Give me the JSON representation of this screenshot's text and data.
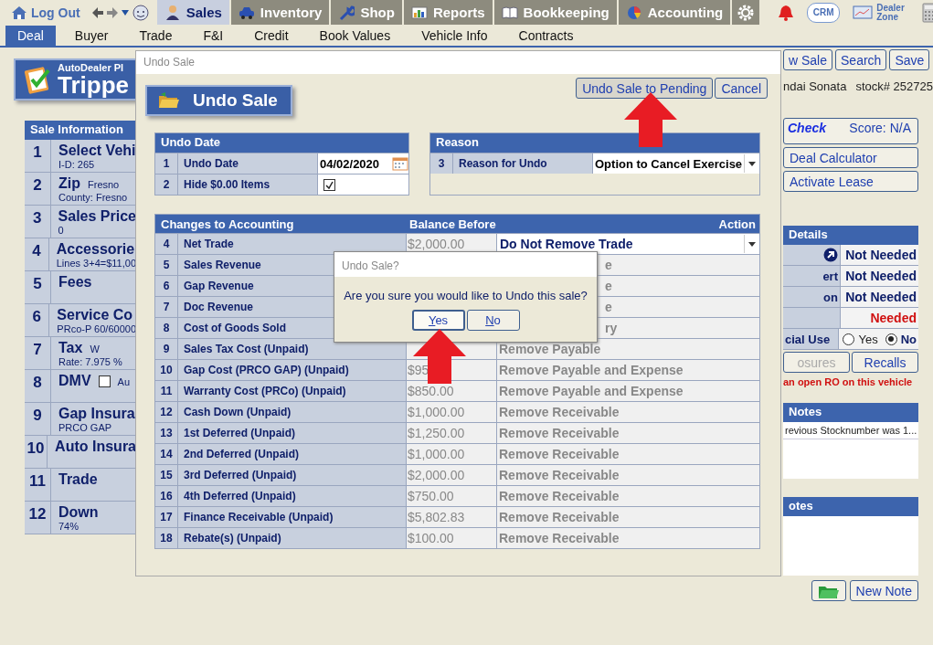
{
  "nav": {
    "logout": "Log Out",
    "tabs": [
      {
        "label": "Sales",
        "selected": true
      },
      {
        "label": "Inventory",
        "selected": false
      },
      {
        "label": "Shop",
        "selected": false
      },
      {
        "label": "Reports",
        "selected": false
      },
      {
        "label": "Bookkeeping",
        "selected": false
      },
      {
        "label": "Accounting",
        "selected": false
      }
    ],
    "crm": "CRM",
    "dealer_zone": "Dealer Zone"
  },
  "subtabs": [
    {
      "label": "Deal",
      "selected": true
    },
    {
      "label": "Buyer",
      "selected": false
    },
    {
      "label": "Trade",
      "selected": false
    },
    {
      "label": "F&I",
      "selected": false
    },
    {
      "label": "Credit",
      "selected": false
    },
    {
      "label": "Book Values",
      "selected": false
    },
    {
      "label": "Vehicle Info",
      "selected": false
    },
    {
      "label": "Contracts",
      "selected": false
    }
  ],
  "logo": {
    "line1": "AutoDealer Pl",
    "line2": "Trippe"
  },
  "sale_info": {
    "title": "Sale Information",
    "rows": [
      {
        "num": "1",
        "title": "Select Vehi",
        "sub": "I-D:  265"
      },
      {
        "num": "2",
        "title": "Zip",
        "extra": "Fresno",
        "sub": "County:  Fresno"
      },
      {
        "num": "3",
        "title": "Sales Price",
        "sub": "0"
      },
      {
        "num": "4",
        "title": "Accessorie",
        "sub": "Lines 3+4=$11,00"
      },
      {
        "num": "5",
        "title": "Fees"
      },
      {
        "num": "6",
        "title": "Service Co",
        "sub": "PRco-P 60/60000"
      },
      {
        "num": "7",
        "title": "Tax",
        "extra": "W",
        "sub": "Rate: 7.975 %"
      },
      {
        "num": "8",
        "title": "DMV",
        "checked": false,
        "extra": "Au"
      },
      {
        "num": "9",
        "title": "Gap Insura",
        "sub": "PRCO GAP"
      },
      {
        "num": "10",
        "title": "Auto Insura"
      },
      {
        "num": "11",
        "title": "Trade"
      },
      {
        "num": "12",
        "title": "Down",
        "sub": "74%"
      }
    ]
  },
  "right": {
    "top_buttons": [
      "w Sale",
      "Search",
      "Save"
    ],
    "vehicle": "ndai Sonata",
    "stock": "stock# 252725",
    "check": {
      "label": "Check",
      "score": "Score:  N/A"
    },
    "buttons": [
      "Deal Calculator",
      "Activate Lease"
    ],
    "details": {
      "title": "Details",
      "rows": [
        {
          "kind": "icon",
          "value": "Not Needed",
          "needed": false
        },
        {
          "kind": "status",
          "label": "ert",
          "value": "Not Needed",
          "needed": false
        },
        {
          "kind": "status",
          "label": "on",
          "value": "Not Needed",
          "needed": false
        },
        {
          "kind": "status",
          "value": "Needed",
          "needed": true
        },
        {
          "kind": "radio",
          "label": "cial Use",
          "options": [
            {
              "label": "Yes",
              "selected": false
            },
            {
              "label": "No",
              "selected": true
            }
          ]
        }
      ]
    },
    "actions": [
      {
        "label": "osures",
        "disabled": true
      },
      {
        "label": "Recalls",
        "disabled": false
      }
    ],
    "warning": "an open RO on this vehicle",
    "notes": {
      "title": "Notes",
      "items": [
        "revious Stocknumber was 1..."
      ]
    },
    "notes2": {
      "title": "otes"
    },
    "new_note": "New Note"
  },
  "dialog": {
    "title": "Undo Sale",
    "header": "Undo Sale",
    "buttons": [
      "Undo Sale to Pending",
      "Cancel"
    ],
    "undo_date": {
      "title": "Undo Date",
      "rows": [
        {
          "num": "1",
          "label": "Undo Date",
          "kind": "date",
          "value": "04/02/2020"
        },
        {
          "num": "2",
          "label": "Hide $0.00 Items",
          "kind": "checkbox",
          "checked": true
        }
      ]
    },
    "reason": {
      "title": "Reason",
      "rows": [
        {
          "num": "3",
          "label": "Reason for Undo",
          "kind": "select",
          "value": "Option to Cancel Exercise"
        }
      ]
    },
    "changes": {
      "columns": [
        "Changes to Accounting",
        "Balance Before",
        "Action"
      ],
      "rows": [
        {
          "num": "4",
          "label": "Net Trade",
          "balance": "$2,000.00",
          "kind": "select",
          "action": "Do Not Remove Trade"
        },
        {
          "num": "5",
          "label": "Sales Revenue",
          "kind": "partial",
          "action": "e"
        },
        {
          "num": "6",
          "label": "Gap Revenue",
          "kind": "partial",
          "action": "e"
        },
        {
          "num": "7",
          "label": "Doc Revenue",
          "kind": "partial",
          "action": "e"
        },
        {
          "num": "8",
          "label": "Cost of Goods Sold",
          "kind": "partial",
          "action": "ry"
        },
        {
          "num": "9",
          "label": "Sales Tax Cost (Unpaid)",
          "kind": "text",
          "action": "Remove Payable"
        },
        {
          "num": "10",
          "label": "Gap Cost (PRCO GAP) (Unpaid)",
          "balance": "$95",
          "kind": "text",
          "action": "Remove Payable and Expense"
        },
        {
          "num": "11",
          "label": "Warranty Cost (PRCo) (Unpaid)",
          "balance": "$850.00",
          "kind": "text",
          "action": "Remove Payable and Expense"
        },
        {
          "num": "12",
          "label": "Cash Down (Unpaid)",
          "balance": "$1,000.00",
          "kind": "text",
          "action": "Remove Receivable"
        },
        {
          "num": "13",
          "label": "1st Deferred (Unpaid)",
          "balance": "$1,250.00",
          "kind": "text",
          "action": "Remove Receivable"
        },
        {
          "num": "14",
          "label": "2nd Deferred (Unpaid)",
          "balance": "$1,000.00",
          "kind": "text",
          "action": "Remove Receivable"
        },
        {
          "num": "15",
          "label": "3rd Deferred (Unpaid)",
          "balance": "$2,000.00",
          "kind": "text",
          "action": "Remove Receivable"
        },
        {
          "num": "16",
          "label": "4th Deferred (Unpaid)",
          "balance": "$750.00",
          "kind": "text",
          "action": "Remove Receivable"
        },
        {
          "num": "17",
          "label": "Finance Receivable (Unpaid)",
          "balance": "$5,802.83",
          "kind": "text",
          "action": "Remove Receivable"
        },
        {
          "num": "18",
          "label": "Rebate(s) (Unpaid)",
          "balance": "$100.00",
          "kind": "text",
          "action": "Remove Receivable"
        }
      ]
    }
  },
  "confirm": {
    "title": "Undo Sale?",
    "message": "Are you sure you would like to Undo this sale?",
    "buttons": [
      {
        "label": "Yes",
        "focused": true
      },
      {
        "label": "No",
        "focused": false
      }
    ]
  }
}
